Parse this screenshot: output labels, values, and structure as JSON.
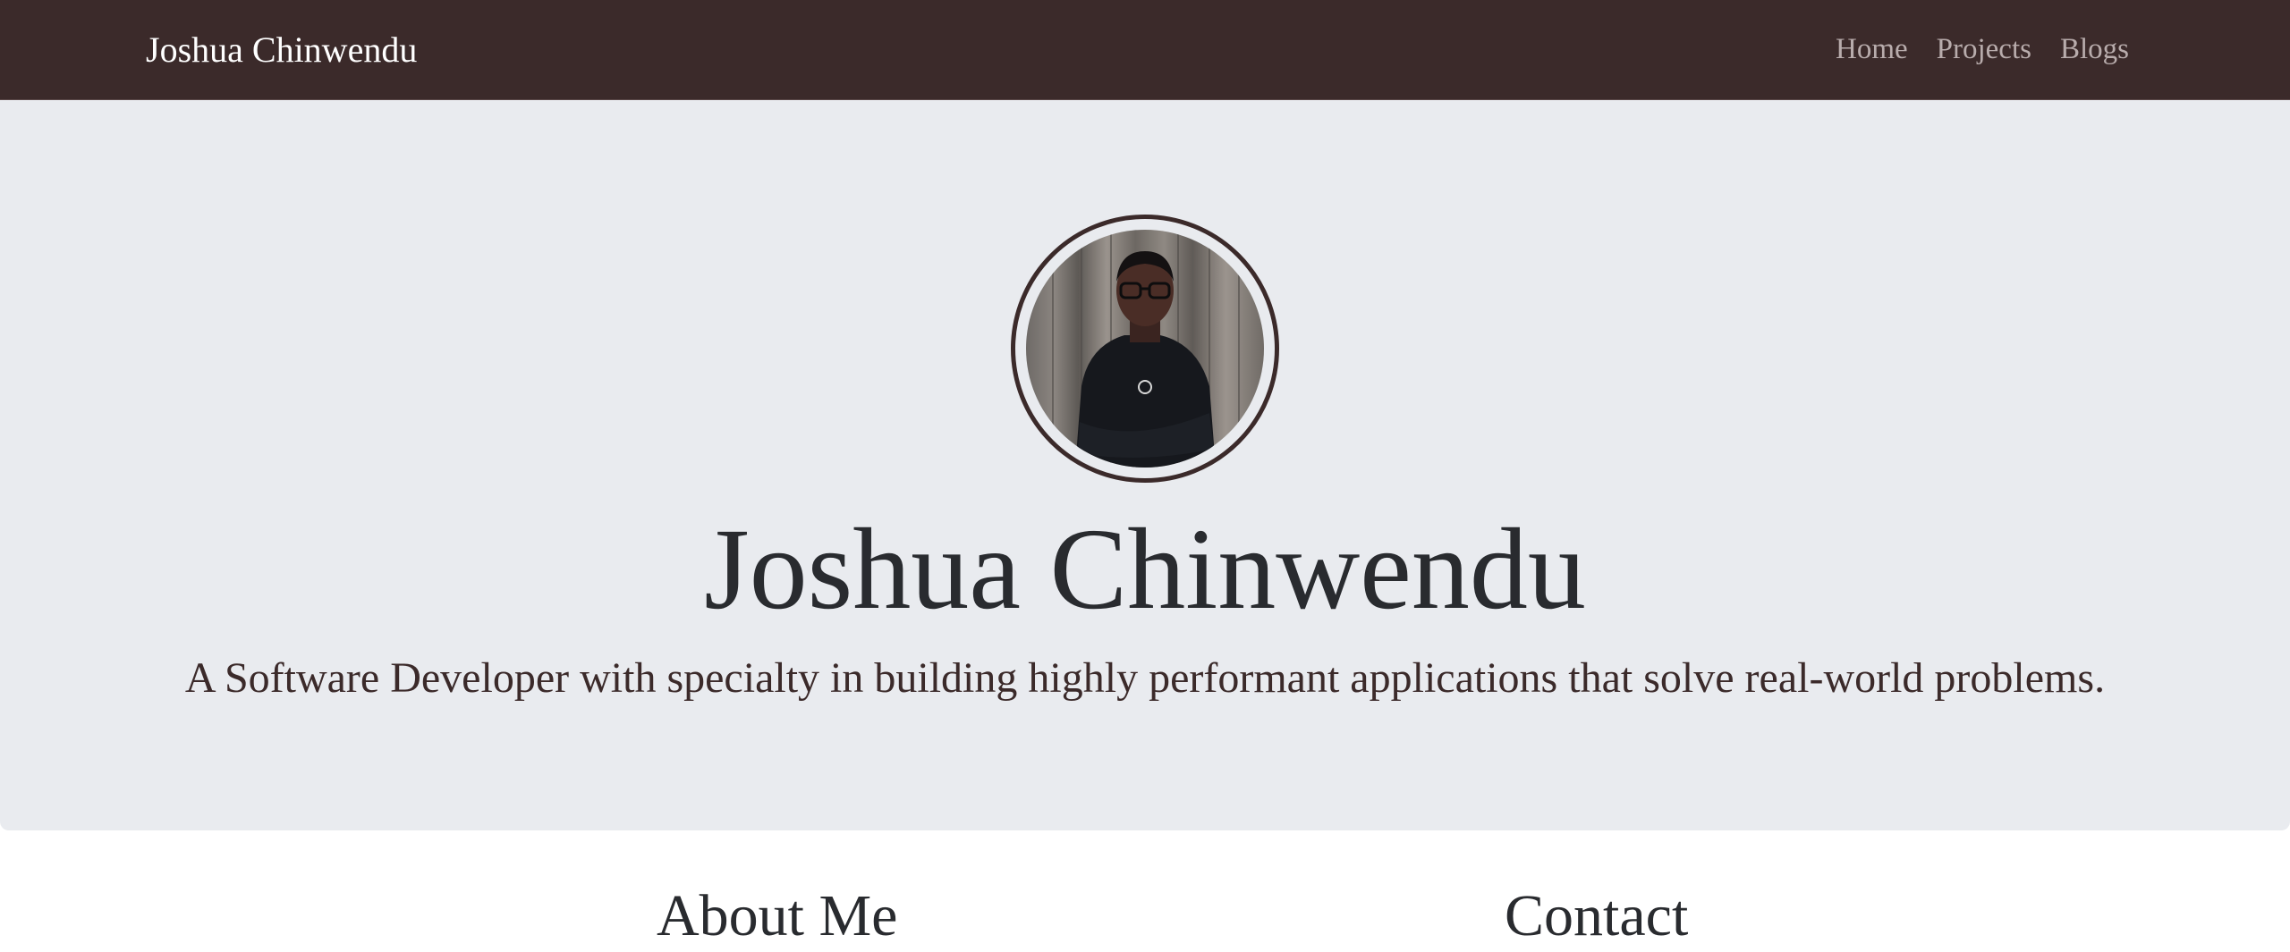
{
  "navbar": {
    "brand": "Joshua Chinwendu",
    "links": [
      {
        "label": "Home"
      },
      {
        "label": "Projects"
      },
      {
        "label": "Blogs"
      }
    ]
  },
  "hero": {
    "title": "Joshua Chinwendu",
    "subtitle": "A Software Developer with specialty in building highly performant applications that solve real-world problems."
  },
  "sections": {
    "about_heading": "About Me",
    "contact_heading": "Contact"
  },
  "colors": {
    "navbar_bg": "#3b2a2a",
    "hero_bg": "#e9ebef",
    "nav_link": "#b8acac",
    "heading_text": "#292b2f"
  }
}
